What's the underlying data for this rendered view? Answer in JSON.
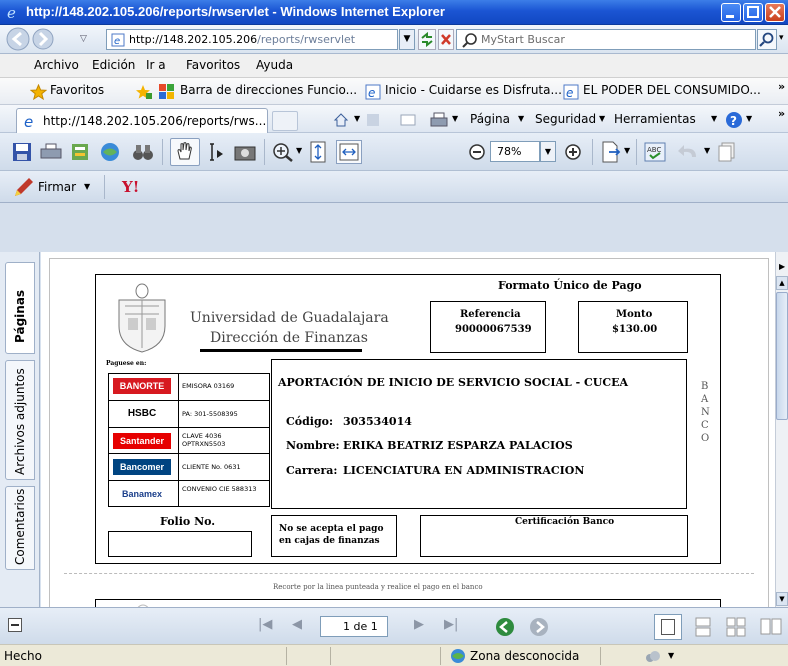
{
  "window": {
    "title": "http://148.202.105.206/reports/rwservlet - Windows Internet Explorer"
  },
  "address": {
    "url_host": "http://148.202.105.206",
    "url_path": "/reports/rwservlet",
    "search_placeholder": "MyStart Buscar"
  },
  "menu": {
    "items": [
      "Archivo",
      "Edición",
      "Ir a",
      "Favoritos",
      "Ayuda"
    ]
  },
  "favorites": {
    "label": "Favoritos",
    "links": [
      "Barra de direcciones Funcio...",
      "Inicio - Cuidarse es Disfruta...",
      "EL PODER DEL CONSUMIDO..."
    ]
  },
  "tabs": {
    "active_tab": "http://148.202.105.206/reports/rws...",
    "pagina": "Página",
    "seguridad": "Seguridad",
    "herramientas": "Herramientas"
  },
  "pdf_toolbar": {
    "zoom": "78%",
    "firmar": "Firmar"
  },
  "side_panel": {
    "tabs": [
      "Páginas",
      "Archivos adjuntos",
      "Comentarios"
    ]
  },
  "document": {
    "title": "Formato Único de Pago",
    "university": "Universidad de Guadalajara",
    "department": "Dirección de Finanzas",
    "referencia_label": "Referencia",
    "referencia_value": "90000067539",
    "monto_label": "Monto",
    "monto_value": "$130.00",
    "paguese_en": "Paguese en:",
    "banks": [
      {
        "name": "BANORTE",
        "ref": "EMISORA 03169",
        "color": "#d71920"
      },
      {
        "name": "HSBC",
        "ref": "PA: 301-5508395",
        "color": "#db0011"
      },
      {
        "name": "Santander",
        "ref": "CLAVE 4036 OPTRXN5503",
        "color": "#e60000"
      },
      {
        "name": "Bancomer",
        "ref": "CLIENTE No. 0631",
        "color": "#004481"
      },
      {
        "name": "Banamex",
        "ref": "CONVENIO CIE 588313",
        "color": "#1b3f8b"
      }
    ],
    "concept": "APORTACIÓN DE INICIO DE SERVICIO SOCIAL - CUCEA",
    "codigo_label": "Código:",
    "codigo_value": "303534014",
    "nombre_label": "Nombre:",
    "nombre_value": "ERIKA BEATRIZ ESPARZA PALACIOS",
    "carrera_label": "Carrera:",
    "carrera_value": "LICENCIATURA EN ADMINISTRACION",
    "banco_vertical": [
      "B",
      "A",
      "N",
      "C",
      "O"
    ],
    "folio_label": "Folio No.",
    "no_acepta": "No se acepta el pago en cajas de finanzas",
    "certificacion": "Certificación Banco",
    "cut_line": "Recorte por la linea punteada y realice el pago en el banco"
  },
  "nav": {
    "page_indicator": "1 de 1"
  },
  "status": {
    "left": "Hecho",
    "zone": "Zona desconocida"
  }
}
